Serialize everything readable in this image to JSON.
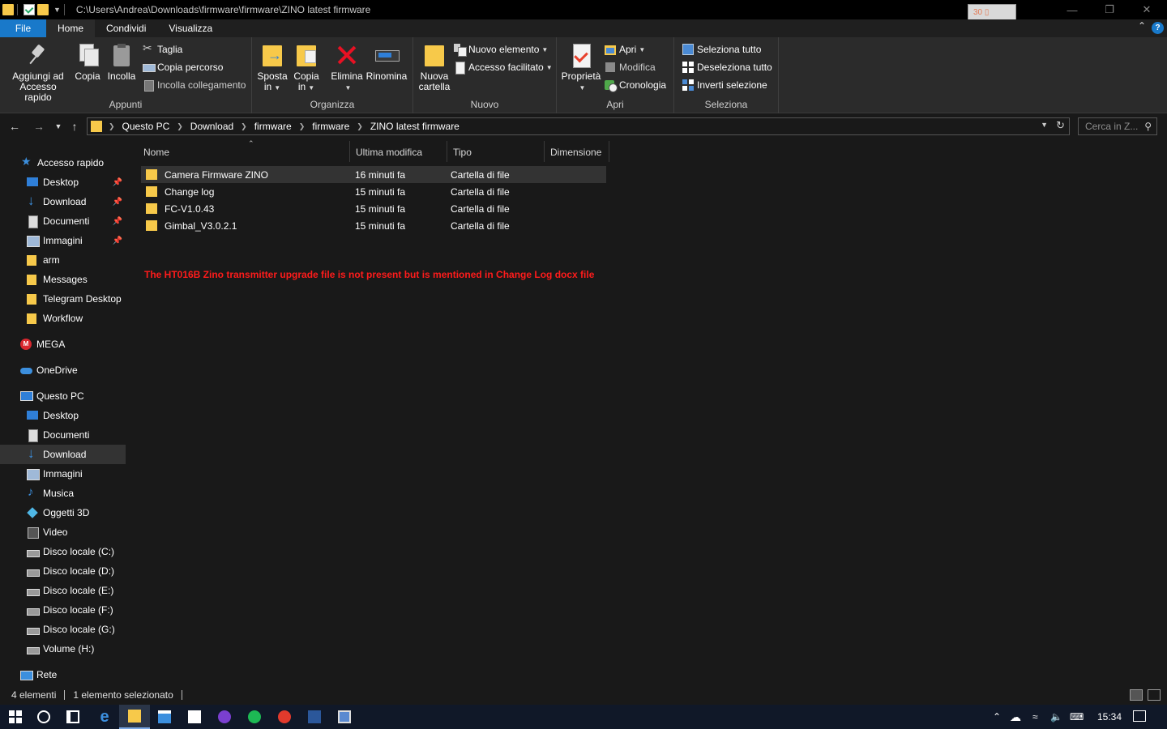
{
  "window": {
    "title_path": "C:\\Users\\Andrea\\Downloads\\firmware\\firmware\\ZINO latest firmware",
    "mini_box_text": "30"
  },
  "ribbon_tabs": [
    "File",
    "Home",
    "Condividi",
    "Visualizza"
  ],
  "ribbon": {
    "appunti": {
      "label": "Appunti",
      "pin_line1": "Aggiungi ad",
      "pin_line2": "Accesso rapido",
      "copy": "Copia",
      "paste": "Incolla",
      "cut": "Taglia",
      "copy_path": "Copia percorso",
      "paste_link": "Incolla collegamento"
    },
    "organizza": {
      "label": "Organizza",
      "move_line1": "Sposta",
      "move_line2": "in",
      "copyto_line1": "Copia",
      "copyto_line2": "in",
      "delete": "Elimina",
      "rename": "Rinomina"
    },
    "nuovo": {
      "label": "Nuovo",
      "new_folder_line1": "Nuova",
      "new_folder_line2": "cartella",
      "new_item": "Nuovo elemento",
      "easy_access": "Accesso facilitato"
    },
    "apri": {
      "label": "Apri",
      "properties": "Proprietà",
      "open": "Apri",
      "edit": "Modifica",
      "history": "Cronologia"
    },
    "seleziona": {
      "label": "Seleziona",
      "select_all": "Seleziona tutto",
      "select_none": "Deseleziona tutto",
      "invert": "Inverti selezione"
    }
  },
  "address": {
    "breadcrumbs": [
      "Questo PC",
      "Download",
      "firmware",
      "firmware",
      "ZINO latest firmware"
    ],
    "search_placeholder": "Cerca in Z..."
  },
  "sidebar": {
    "quick_access": "Accesso rapido",
    "quick_items": [
      "Desktop",
      "Download",
      "Documenti",
      "Immagini",
      "arm",
      "Messages",
      "Telegram Desktop",
      "Workflow"
    ],
    "mega": "MEGA",
    "onedrive": "OneDrive",
    "this_pc": "Questo PC",
    "pc_items": [
      "Desktop",
      "Documenti",
      "Download",
      "Immagini",
      "Musica",
      "Oggetti 3D",
      "Video",
      "Disco locale (C:)",
      "Disco locale (D:)",
      "Disco locale (E:)",
      "Disco locale (F:)",
      "Disco locale (G:)",
      "Volume (H:)"
    ],
    "network": "Rete"
  },
  "columns": [
    "Nome",
    "Ultima modifica",
    "Tipo",
    "Dimensione"
  ],
  "files": [
    {
      "name": "Camera Firmware ZINO",
      "modified": "16 minuti fa",
      "type": "Cartella di file"
    },
    {
      "name": "Change log",
      "modified": "15 minuti fa",
      "type": "Cartella di file"
    },
    {
      "name": "FC-V1.0.43",
      "modified": "15 minuti fa",
      "type": "Cartella di file"
    },
    {
      "name": "Gimbal_V3.0.2.1",
      "modified": "15 minuti fa",
      "type": "Cartella di file"
    }
  ],
  "note": "The HT016B Zino transmitter upgrade file is not present but is mentioned in Change Log  docx file",
  "status": {
    "count": "4 elementi",
    "selected": "1 elemento selezionato"
  },
  "taskbar": {
    "clock": "15:34"
  },
  "colors": {
    "accent": "#1979ca",
    "folder": "#f7c94a",
    "note_red": "#ff1b1b",
    "background": "#191919"
  }
}
